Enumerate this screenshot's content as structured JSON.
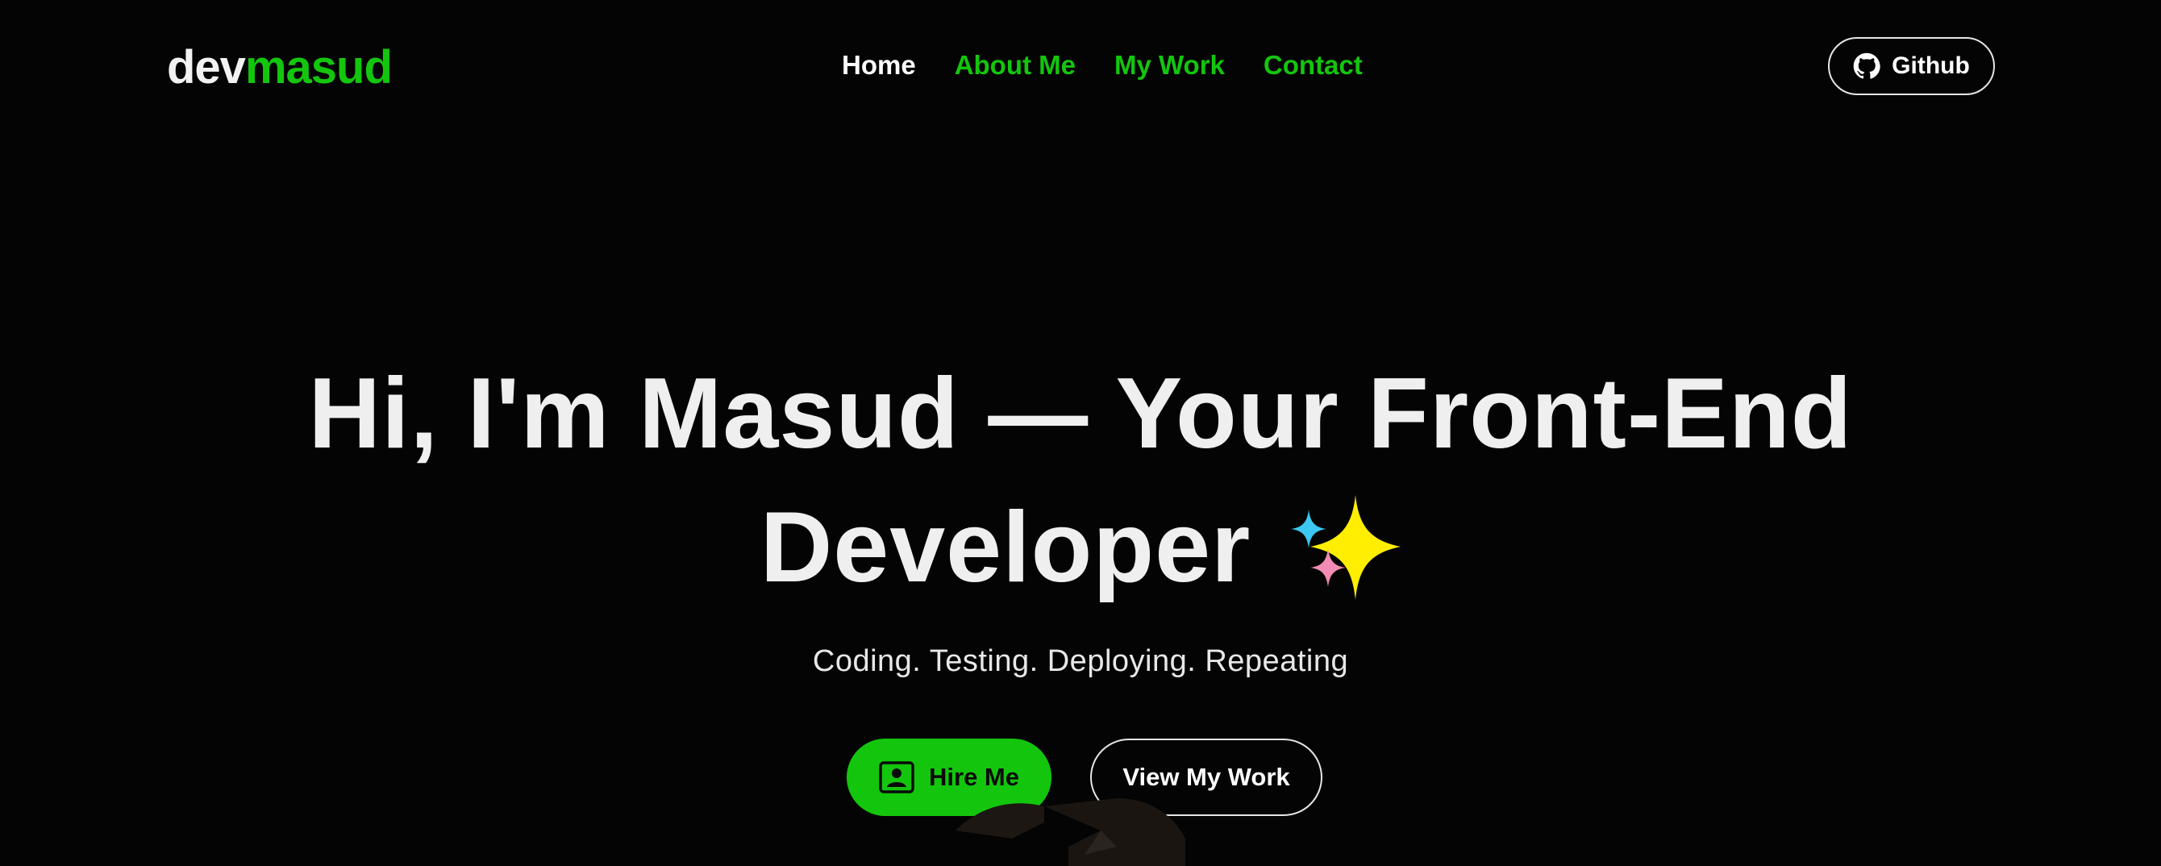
{
  "brand": {
    "part1": "dev",
    "part2": "masud"
  },
  "nav": [
    {
      "label": "Home"
    },
    {
      "label": "About Me"
    },
    {
      "label": "My Work"
    },
    {
      "label": "Contact"
    }
  ],
  "github": {
    "label": "Github",
    "icon": "github-icon"
  },
  "hero": {
    "title_line1": "Hi, I'm Masud — Your Front-End",
    "title_line2": "Developer",
    "emoji_icon": "sparkles-icon",
    "subtitle": "Coding. Testing. Deploying. Repeating"
  },
  "cta": {
    "hire_label": "Hire Me",
    "hire_icon": "contact-card-icon",
    "work_label": "View My Work"
  },
  "colors": {
    "background": "#040404",
    "accent": "#13c60d",
    "text": "#efefef"
  }
}
